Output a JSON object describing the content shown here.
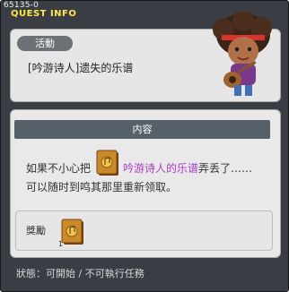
{
  "window": {
    "quest_id": "65135-0",
    "title": "QUEST INFO"
  },
  "event": {
    "badge": "活動",
    "quest_name": "[吟游诗人]遗失的乐谱"
  },
  "content": {
    "header": "内容",
    "line1_prefix": "如果不小心把",
    "line1_item": "吟游诗人的乐谱",
    "line1_suffix": "弄丢了……",
    "line2": "可以随时到鸣其那里重新领取。"
  },
  "reward": {
    "label": "獎勵",
    "count": "1"
  },
  "status": {
    "text": "狀態：可開始 / 不可執行任務"
  },
  "colors": {
    "accent_title": "#ffe94a",
    "item_highlight": "#b03cc8",
    "header_bar": "#556069"
  }
}
